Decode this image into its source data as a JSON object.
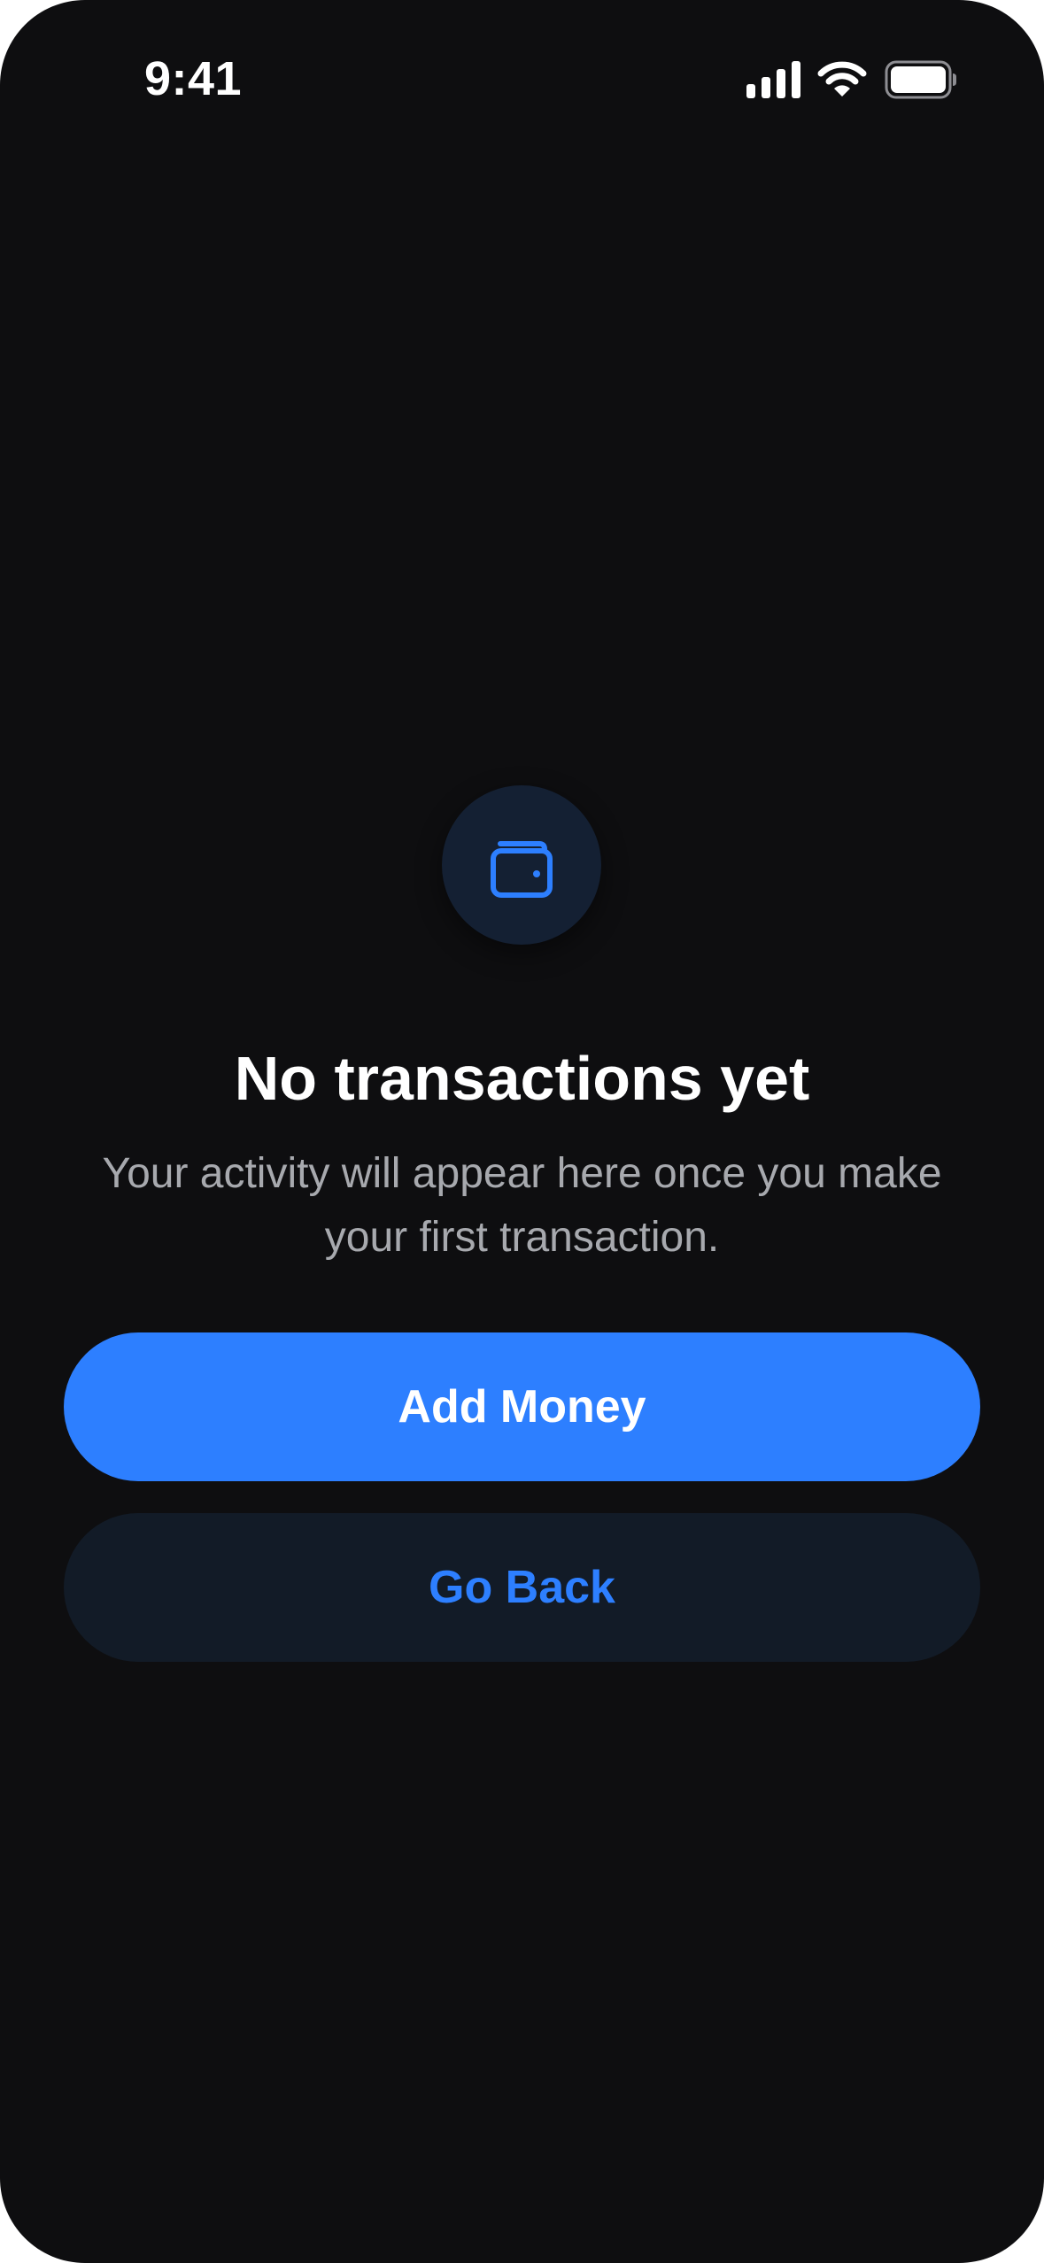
{
  "status_bar": {
    "time": "9:41",
    "icons": [
      "signal-icon",
      "wifi-icon",
      "battery-icon"
    ]
  },
  "empty_state": {
    "icon": "wallet-icon",
    "title": "No transactions yet",
    "subtitle": "Your activity will appear here once you make your first transaction."
  },
  "actions": {
    "primary_label": "Add Money",
    "secondary_label": "Go Back"
  },
  "colors": {
    "background": "#0e0e10",
    "accent": "#2d7fff",
    "icon_circle": "#142033",
    "secondary_button": "#121b27",
    "subtitle_text": "#a7a9ae"
  }
}
